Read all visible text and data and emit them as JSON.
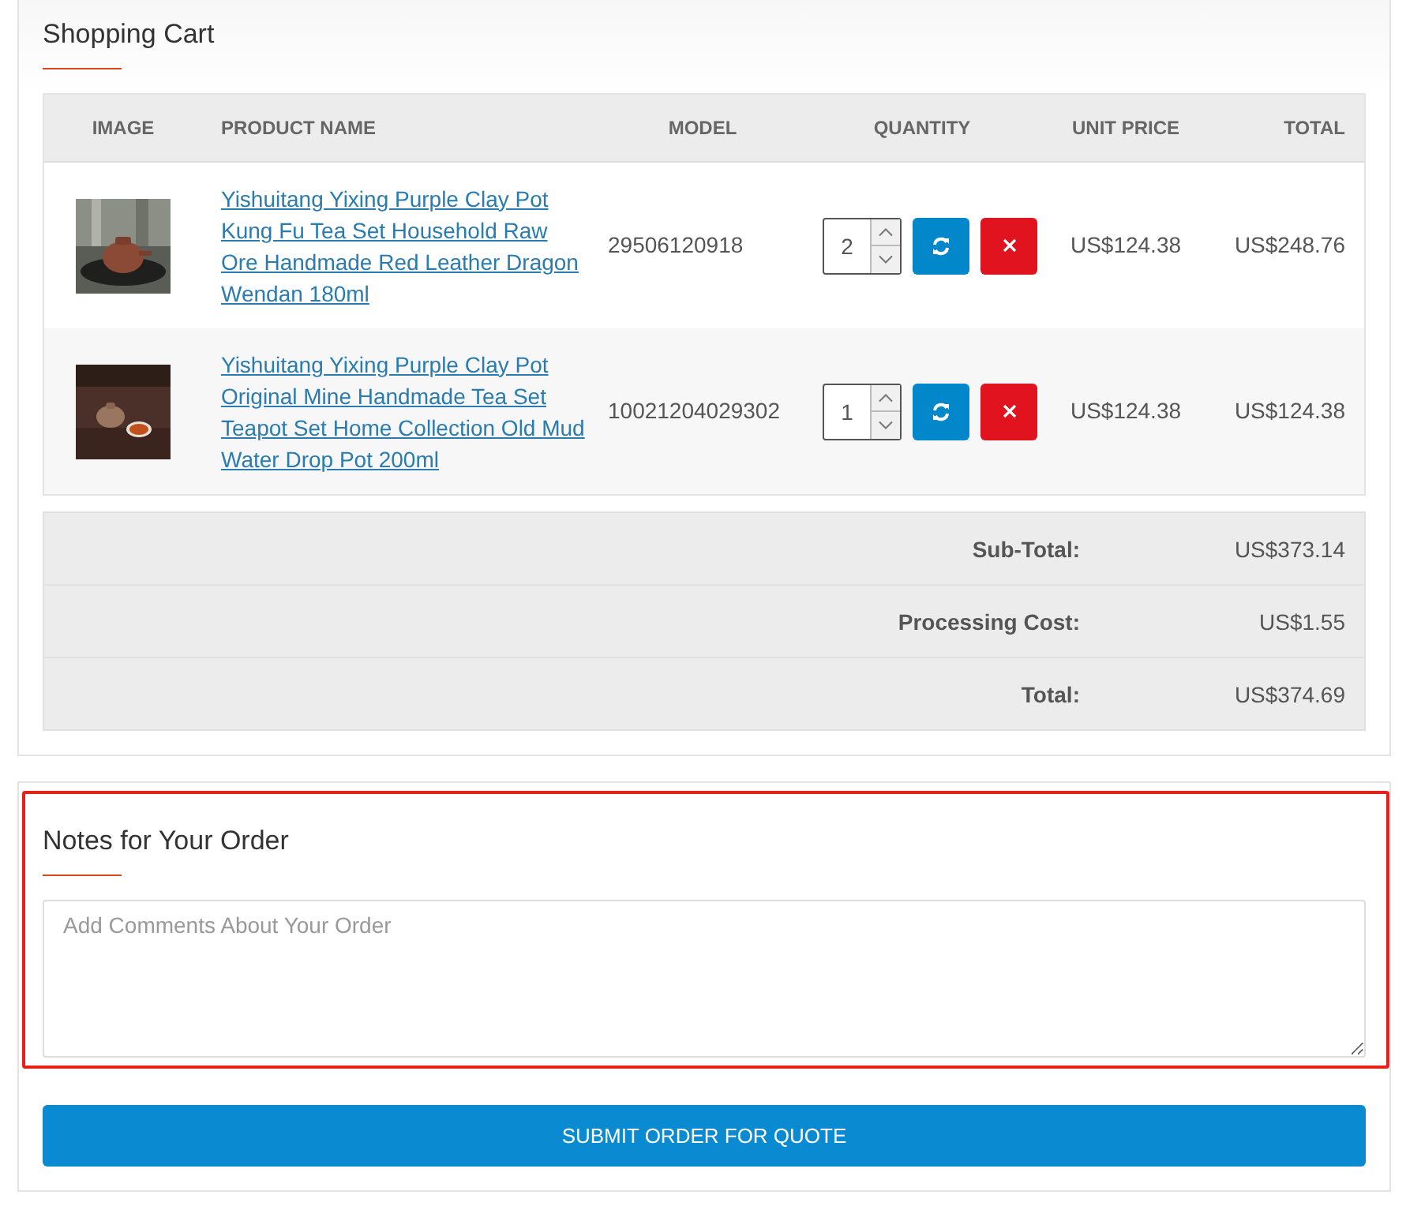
{
  "cart": {
    "title": "Shopping Cart",
    "columns": [
      "IMAGE",
      "PRODUCT NAME",
      "MODEL",
      "QUANTITY",
      "UNIT PRICE",
      "TOTAL"
    ],
    "rows": [
      {
        "name": "Yishuitang Yixing Purple Clay Pot Kung Fu Tea Set Household Raw Ore Handmade Red Leather Dragon Wendan 180ml",
        "model": "29506120918",
        "quantity": "2",
        "unit_price": "US$124.38",
        "total": "US$248.76"
      },
      {
        "name": "Yishuitang Yixing Purple Clay Pot Original Mine Handmade Tea Set Teapot Set Home Collection Old Mud Water Drop Pot 200ml",
        "model": "10021204029302",
        "quantity": "1",
        "unit_price": "US$124.38",
        "total": "US$124.38"
      }
    ],
    "totals": [
      {
        "label": "Sub-Total:",
        "value": "US$373.14"
      },
      {
        "label": "Processing Cost:",
        "value": "US$1.55"
      },
      {
        "label": "Total:",
        "value": "US$374.69"
      }
    ]
  },
  "notes": {
    "title": "Notes for Your Order",
    "placeholder": "Add Comments About Your Order",
    "highlighted": true
  },
  "submit": {
    "label": "SUBMIT ORDER FOR QUOTE"
  }
}
